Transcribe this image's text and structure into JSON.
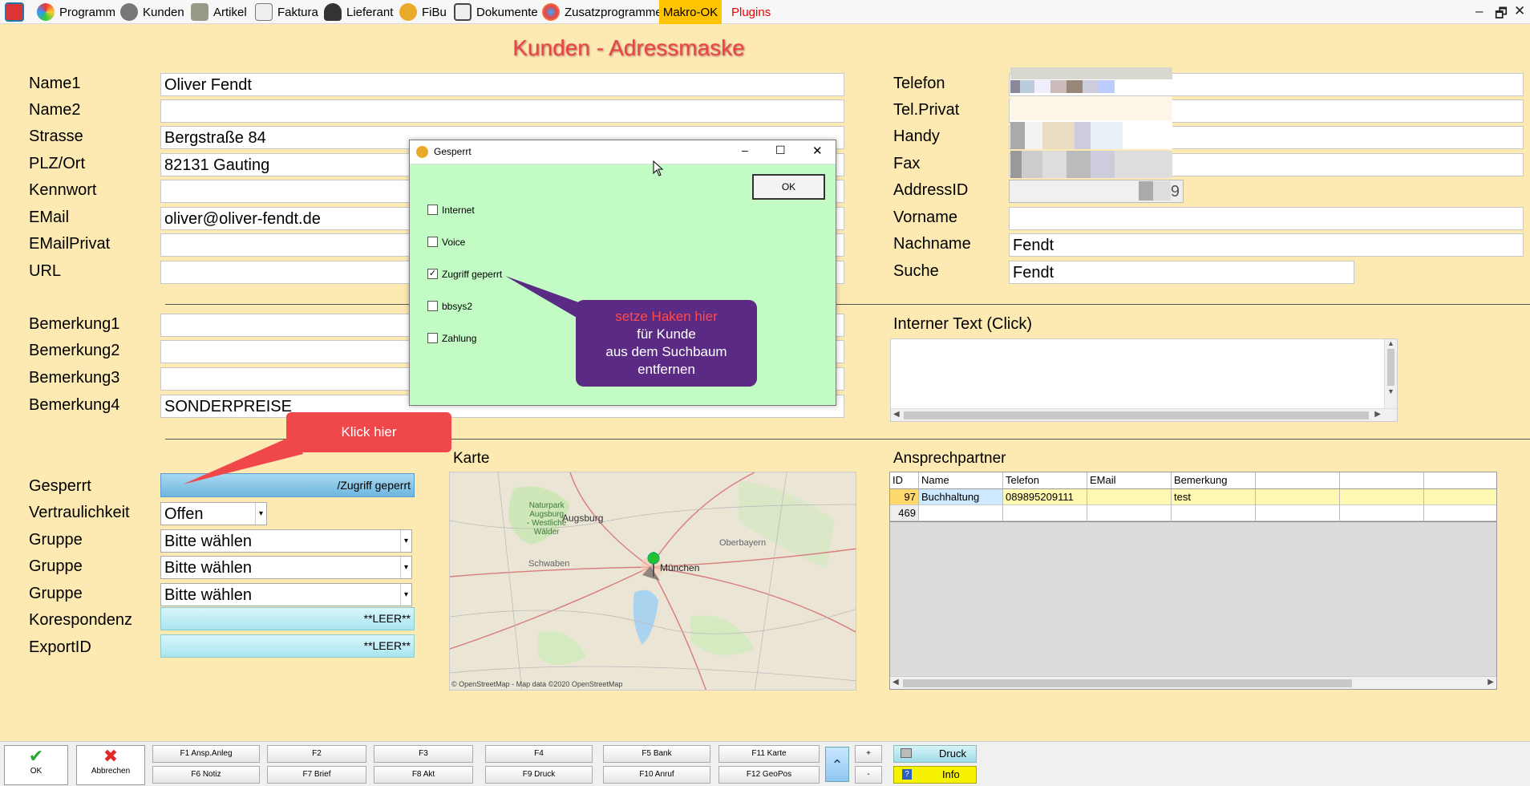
{
  "menu": {
    "items": [
      "Programm",
      "Kunden",
      "Artikel",
      "Faktura",
      "Lieferant",
      "FiBu",
      "Dokumente",
      "Zusatzprogramme"
    ],
    "makro": "Makro-OK",
    "plugins": "Plugins",
    "win_min": "–",
    "win_restore": "🗗",
    "win_close": "✕"
  },
  "form": {
    "title": "Kunden - Adressmaske",
    "left_labels": [
      "Name1",
      "Name2",
      "Strasse",
      "PLZ/Ort",
      "Kennwort",
      "EMail",
      "EMailPrivat",
      "URL"
    ],
    "left_values": [
      "Oliver Fendt",
      "",
      "Bergstraße 84",
      "82131 Gauting",
      "",
      "oliver@oliver-fendt.de",
      "",
      ""
    ],
    "right_labels": [
      "Telefon",
      "Tel.Privat",
      "Handy",
      "Fax",
      "AddressID",
      "Vorname",
      "Nachname",
      "Suche"
    ],
    "address_id_suffix": "9",
    "vorname": "",
    "nachname": "Fendt",
    "suche": "Fendt",
    "bem_labels": [
      "Bemerkung1",
      "Bemerkung2",
      "Bemerkung3",
      "Bemerkung4"
    ],
    "bem_values": [
      "",
      "",
      "",
      "SONDERPREISE"
    ],
    "interner_text": "Interner Text (Click)",
    "lower_labels": [
      "Gesperrt",
      "Vertraulichkeit",
      "Gruppe",
      "Gruppe",
      "Gruppe",
      "Korespondenz",
      "ExportID"
    ],
    "gesperrt_value": "/Zugriff geperrt",
    "vertraulichkeit": "Offen",
    "gruppe_values": [
      "Bitte wählen",
      "Bitte wählen",
      "Bitte wählen"
    ],
    "korespondenz": "**LEER**",
    "exportid": "**LEER**",
    "karte_label": "Karte",
    "ansprech_label": "Ansprechpartner"
  },
  "dialog": {
    "title": "Gesperrt",
    "ok": "OK",
    "options": [
      {
        "label": "Internet",
        "checked": false
      },
      {
        "label": "Voice",
        "checked": false
      },
      {
        "label": "Zugriff geperrt",
        "checked": true
      },
      {
        "label": "bbsys2",
        "checked": false
      },
      {
        "label": "Zahlung",
        "checked": false
      }
    ]
  },
  "callouts": {
    "purple_line1": "setze Haken hier",
    "purple_line2": "für Kunde",
    "purple_line3": "aus dem Suchbaum",
    "purple_line4": "entfernen",
    "red": "Klick hier"
  },
  "map": {
    "places": [
      "Naturpark",
      "Augsburg",
      "- Westliche",
      "Wälder",
      "Augsburg",
      "Schwaben",
      "Oberbayern",
      "München"
    ],
    "attribution": "© OpenStreetMap - Map data ©2020 OpenStreetMap"
  },
  "grid": {
    "headers": [
      "ID",
      "Name",
      "Telefon",
      "EMail",
      "Bemerkung",
      "",
      "",
      ""
    ],
    "rows": [
      [
        "97",
        "Buchhaltung",
        "089895209111",
        "",
        "test"
      ],
      [
        "469",
        "",
        "",
        "",
        ""
      ]
    ]
  },
  "bottom": {
    "ok": "OK",
    "abbrechen": "Abbrechen",
    "fkeys_top": [
      "F1 Ansp.Anleg",
      "F2",
      "F3",
      "F4",
      "F5 Bank",
      "F11 Karte"
    ],
    "fkeys_bottom": [
      "F6 Notiz",
      "F7 Brief",
      "F8 Akt",
      "F9 Druck",
      "F10 Anruf",
      "F12 GeoPos"
    ],
    "plus": "+",
    "minus": "-",
    "druck": "Druck",
    "info": "Info"
  },
  "colors": {
    "accent_red": "#e8473f",
    "dialog_bg": "#c2fcc4",
    "callout_purple": "#5b2a84",
    "form_bg": "#fde9b2"
  }
}
